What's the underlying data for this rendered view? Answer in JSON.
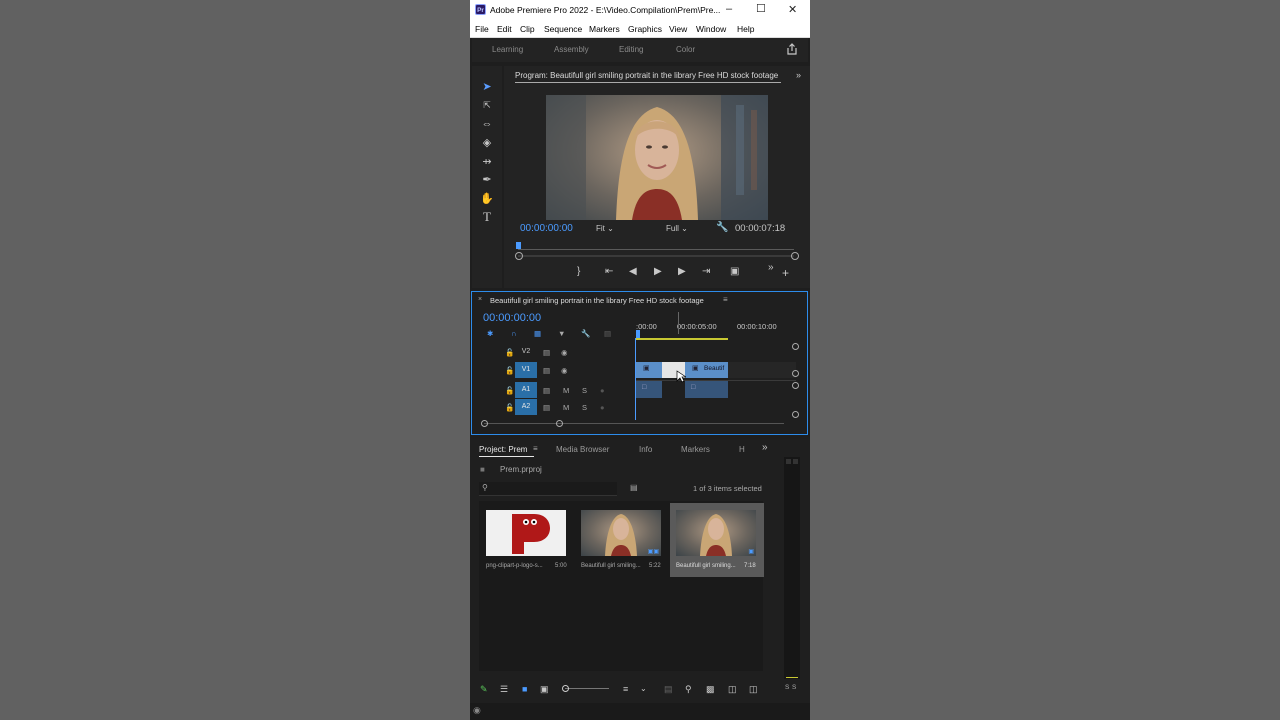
{
  "window": {
    "title": "Adobe Premiere Pro 2022 - E:\\Video.Compilation\\Prem\\Pre...",
    "logo": "Pr",
    "controls": [
      "minimize-icon",
      "maximize-icon",
      "close-icon"
    ]
  },
  "menu": [
    "File",
    "Edit",
    "Clip",
    "Sequence",
    "Markers",
    "Graphics",
    "View",
    "Window",
    "Help"
  ],
  "workspaces": [
    "Learning",
    "Assembly",
    "Editing",
    "Color"
  ],
  "program_monitor": {
    "title": "Program: Beautifull girl smiling portrait in the library Free HD stock footage",
    "timecode_current": "00:00:00:00",
    "fit": "Fit",
    "resolution": "Full",
    "timecode_duration": "00:00:07:18"
  },
  "timeline": {
    "sequence_name": "Beautifull girl smiling portrait in the library Free HD stock footage",
    "timecode": "00:00:00:00",
    "ruler": [
      ":00:00",
      "00:00:05:00",
      "00:00:10:00"
    ],
    "tracks": [
      {
        "name": "V2",
        "active": false
      },
      {
        "name": "V1",
        "active": true
      },
      {
        "name": "A1",
        "active": true
      },
      {
        "name": "A2",
        "active": true
      }
    ],
    "track_m": "M",
    "track_s": "S",
    "clip_label": "Beautif"
  },
  "project": {
    "tabs": [
      "Project: Prem",
      "Media Browser",
      "Info",
      "Markers",
      "H"
    ],
    "project_file": "Prem.prproj",
    "selection_status": "1 of 3 items selected",
    "items": [
      {
        "name": "png-clipart-p-logo-s...",
        "duration": "5:00"
      },
      {
        "name": "Beautifull girl smiling...",
        "duration": "5:22"
      },
      {
        "name": "Beautifull girl smiling...",
        "duration": "7:18"
      }
    ],
    "meter_labels": [
      "S",
      "S"
    ]
  },
  "colors": {
    "accent_blue": "#4b9bff",
    "timeline_border": "#2d8ceb",
    "video_clip": "#5b8fc9",
    "audio_clip": "#36557a"
  }
}
